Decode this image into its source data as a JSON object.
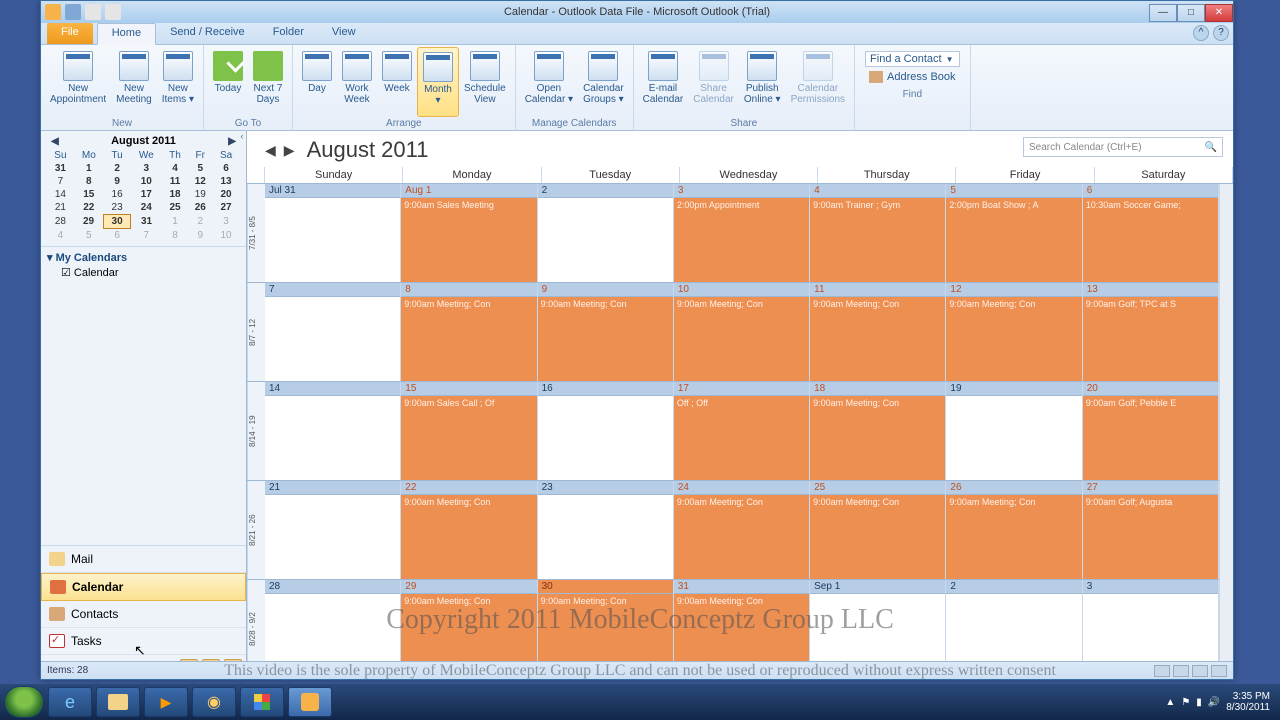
{
  "titlebar": {
    "title": "Calendar - Outlook Data File - Microsoft Outlook (Trial)"
  },
  "tabs": {
    "file": "File",
    "home": "Home",
    "sendrecv": "Send / Receive",
    "folder": "Folder",
    "view": "View"
  },
  "ribbon": {
    "new_appt": "New\nAppointment",
    "new_mtg": "New\nMeeting",
    "new_items": "New\nItems ▾",
    "today": "Today",
    "next7": "Next 7\nDays",
    "day": "Day",
    "workweek": "Work\nWeek",
    "week": "Week",
    "month": "Month\n▾",
    "schedule": "Schedule\nView",
    "opencal": "Open\nCalendar ▾",
    "calgroups": "Calendar\nGroups ▾",
    "email": "E-mail\nCalendar",
    "share": "Share\nCalendar",
    "publish": "Publish\nOnline ▾",
    "perms": "Calendar\nPermissions",
    "findcontact": "Find a Contact",
    "addrbook": "Address Book",
    "g_new": "New",
    "g_goto": "Go To",
    "g_arrange": "Arrange",
    "g_manage": "Manage Calendars",
    "g_share": "Share",
    "g_find": "Find"
  },
  "datepicker": {
    "title": "August 2011",
    "dow": [
      "Su",
      "Mo",
      "Tu",
      "We",
      "Th",
      "Fr",
      "Sa"
    ],
    "rows": [
      [
        {
          "v": "31",
          "cls": "bold"
        },
        {
          "v": "1",
          "cls": "bold"
        },
        {
          "v": "2",
          "cls": "bold"
        },
        {
          "v": "3",
          "cls": "bold"
        },
        {
          "v": "4",
          "cls": "bold"
        },
        {
          "v": "5",
          "cls": "bold"
        },
        {
          "v": "6",
          "cls": "bold"
        }
      ],
      [
        {
          "v": "7"
        },
        {
          "v": "8",
          "cls": "bold"
        },
        {
          "v": "9",
          "cls": "bold"
        },
        {
          "v": "10",
          "cls": "bold"
        },
        {
          "v": "11",
          "cls": "bold"
        },
        {
          "v": "12",
          "cls": "bold"
        },
        {
          "v": "13",
          "cls": "bold"
        }
      ],
      [
        {
          "v": "14"
        },
        {
          "v": "15",
          "cls": "bold"
        },
        {
          "v": "16"
        },
        {
          "v": "17",
          "cls": "bold"
        },
        {
          "v": "18",
          "cls": "bold"
        },
        {
          "v": "19"
        },
        {
          "v": "20",
          "cls": "bold"
        }
      ],
      [
        {
          "v": "21"
        },
        {
          "v": "22",
          "cls": "bold"
        },
        {
          "v": "23"
        },
        {
          "v": "24",
          "cls": "bold"
        },
        {
          "v": "25",
          "cls": "bold"
        },
        {
          "v": "26",
          "cls": "bold"
        },
        {
          "v": "27",
          "cls": "bold"
        }
      ],
      [
        {
          "v": "28"
        },
        {
          "v": "29",
          "cls": "bold"
        },
        {
          "v": "30",
          "cls": "today bold"
        },
        {
          "v": "31",
          "cls": "bold"
        },
        {
          "v": "1",
          "cls": "dim"
        },
        {
          "v": "2",
          "cls": "dim"
        },
        {
          "v": "3",
          "cls": "dim"
        }
      ],
      [
        {
          "v": "4",
          "cls": "dim"
        },
        {
          "v": "5",
          "cls": "dim"
        },
        {
          "v": "6",
          "cls": "dim"
        },
        {
          "v": "7",
          "cls": "dim"
        },
        {
          "v": "8",
          "cls": "dim"
        },
        {
          "v": "9",
          "cls": "dim"
        },
        {
          "v": "10",
          "cls": "dim"
        }
      ]
    ]
  },
  "caltree": {
    "hdr": "My Calendars",
    "item": "Calendar"
  },
  "navbtns": {
    "mail": "Mail",
    "calendar": "Calendar",
    "contacts": "Contacts",
    "tasks": "Tasks"
  },
  "calview": {
    "title": "August 2011",
    "search_placeholder": "Search Calendar (Ctrl+E)",
    "days": [
      "Sunday",
      "Monday",
      "Tuesday",
      "Wednesday",
      "Thursday",
      "Friday",
      "Saturday"
    ],
    "weeks": [
      {
        "label": "7/31 - 8/5",
        "cells": [
          {
            "date": "Jul 31",
            "cls": ""
          },
          {
            "date": "Aug 1",
            "cls": "orange",
            "datecls": "mondate",
            "ev": "9:00am   Sales Meeting"
          },
          {
            "date": "2",
            "cls": ""
          },
          {
            "date": "3",
            "cls": "orange",
            "ev": "2:00pm   Appointment"
          },
          {
            "date": "4",
            "cls": "orange",
            "ev": "9:00am   Trainer ; Gym"
          },
          {
            "date": "5",
            "cls": "orange",
            "ev": "2:00pm   Boat Show ; A"
          },
          {
            "date": "6",
            "cls": "orange",
            "ev": "10:30am  Soccer Game;"
          }
        ]
      },
      {
        "label": "8/7 - 12",
        "cells": [
          {
            "date": "7",
            "cls": ""
          },
          {
            "date": "8",
            "cls": "orange",
            "ev": "9:00am   Meeting; Con"
          },
          {
            "date": "9",
            "cls": "orange",
            "ev": "9:00am   Meeting; Con"
          },
          {
            "date": "10",
            "cls": "orange",
            "ev": "9:00am   Meeting; Con"
          },
          {
            "date": "11",
            "cls": "orange",
            "ev": "9:00am   Meeting; Con"
          },
          {
            "date": "12",
            "cls": "orange",
            "ev": "9:00am   Meeting; Con"
          },
          {
            "date": "13",
            "cls": "orange",
            "ev": "9:00am   Golf; TPC at S"
          }
        ]
      },
      {
        "label": "8/14 - 19",
        "cells": [
          {
            "date": "14",
            "cls": ""
          },
          {
            "date": "15",
            "cls": "orange",
            "ev": "9:00am   Sales Call ; Of"
          },
          {
            "date": "16",
            "cls": ""
          },
          {
            "date": "17",
            "cls": "orange",
            "ev": "Off ; Off"
          },
          {
            "date": "18",
            "cls": "orange",
            "ev": "9:00am   Meeting; Con"
          },
          {
            "date": "19",
            "cls": ""
          },
          {
            "date": "20",
            "cls": "orange",
            "ev": "9:00am   Golf; Pebble E"
          }
        ]
      },
      {
        "label": "8/21 - 26",
        "cells": [
          {
            "date": "21",
            "cls": ""
          },
          {
            "date": "22",
            "cls": "orange",
            "ev": "9:00am   Meeting; Con"
          },
          {
            "date": "23",
            "cls": ""
          },
          {
            "date": "24",
            "cls": "orange",
            "ev": "9:00am   Meeting; Con"
          },
          {
            "date": "25",
            "cls": "orange",
            "ev": "9:00am   Meeting; Con"
          },
          {
            "date": "26",
            "cls": "orange",
            "ev": "9:00am   Meeting; Con"
          },
          {
            "date": "27",
            "cls": "orange",
            "ev": "9:00am   Golf; Augusta"
          }
        ]
      },
      {
        "label": "8/28 - 9/2",
        "cells": [
          {
            "date": "28",
            "cls": ""
          },
          {
            "date": "29",
            "cls": "orange",
            "ev": "9:00am   Meeting; Con"
          },
          {
            "date": "30",
            "cls": "orange",
            "datecls": "today",
            "ev": "9:00am   Meeting; Con"
          },
          {
            "date": "31",
            "cls": "orange",
            "ev": "9:00am   Meeting; Con"
          },
          {
            "date": "Sep 1",
            "cls": "future"
          },
          {
            "date": "2",
            "cls": "future"
          },
          {
            "date": "3",
            "cls": "future"
          }
        ]
      }
    ]
  },
  "status": {
    "items": "Items: 28"
  },
  "watermark": {
    "line1": "Copyright 2011 MobileConceptz Group LLC",
    "line2": "This video is the sole property of MobileConceptz Group LLC and can not be used or reproduced without express written consent"
  },
  "tray": {
    "time": "3:35 PM",
    "date": "8/30/2011"
  }
}
